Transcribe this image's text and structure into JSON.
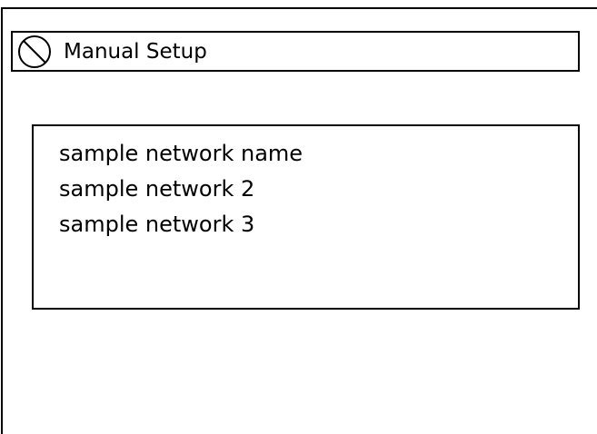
{
  "header": {
    "title": "Manual Setup",
    "icon": "no-entry-icon"
  },
  "networks": [
    {
      "label": "sample network name"
    },
    {
      "label": "sample network 2"
    },
    {
      "label": "sample network 3"
    }
  ]
}
